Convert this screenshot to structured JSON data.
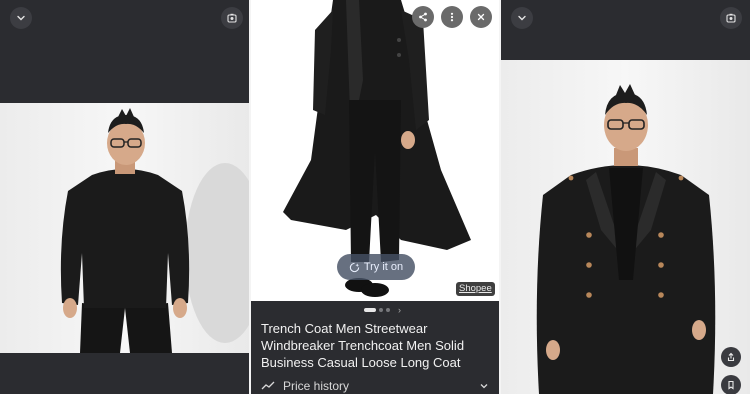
{
  "panels": {
    "left": {
      "expand_icon": "chevron-down-icon",
      "lens_icon": "camera-lens-icon"
    },
    "middle": {
      "action_icons": [
        "share-icon",
        "more-vert-icon",
        "close-icon"
      ],
      "try_on_label": "Try it on",
      "source_label": "Shopee",
      "carousel": {
        "count": 3,
        "active_index": 0
      },
      "product_title": "Trench Coat Men Streetwear Windbreaker Trenchcoat Men Solid Business Casual Loose Long Coat",
      "price_history_label": "Price history"
    },
    "right": {
      "expand_icon": "chevron-down-icon",
      "lens_icon": "camera-lens-icon",
      "side_icons": [
        "share-icon",
        "bookmark-icon"
      ]
    }
  },
  "colors": {
    "panel_dark": "#2b2c30",
    "button_dark": "#3c3d42",
    "try_on_bg": "#465064",
    "coat_black": "#1a1a1a",
    "skin": "#d6a98a"
  }
}
